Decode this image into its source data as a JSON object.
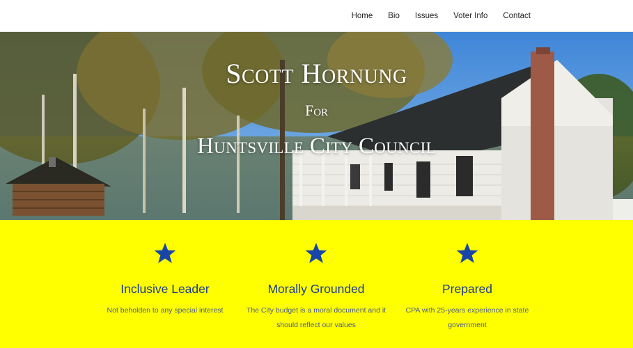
{
  "nav": {
    "items": [
      {
        "label": "Home"
      },
      {
        "label": "Bio"
      },
      {
        "label": "Issues"
      },
      {
        "label": "Voter Info"
      },
      {
        "label": "Contact"
      }
    ]
  },
  "hero": {
    "title": "Scott Hornung",
    "for": "For",
    "subtitle": "Huntsville City Council"
  },
  "features": [
    {
      "icon": "star-icon",
      "heading": "Inclusive Leader",
      "text": "Not beholden to any special interest"
    },
    {
      "icon": "star-icon",
      "heading": "Morally Grounded",
      "text": "The City budget is a moral document and it should reflect our values"
    },
    {
      "icon": "star-icon",
      "heading": "Prepared",
      "text": "CPA with 25-years experience in state government"
    }
  ],
  "colors": {
    "feature_background": "#ffff00",
    "star": "#1846a8",
    "heading": "#1a3a8f"
  }
}
